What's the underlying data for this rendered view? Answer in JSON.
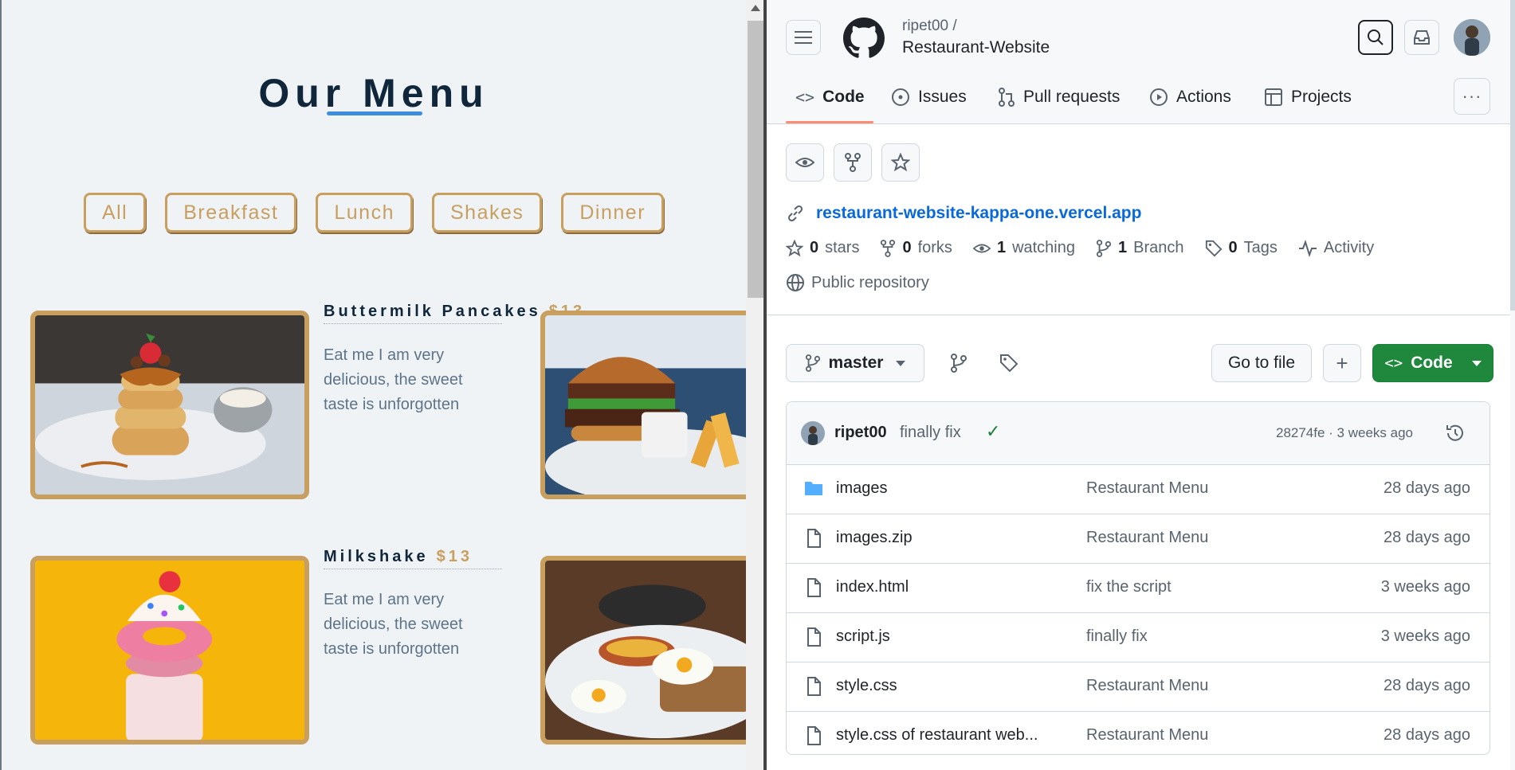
{
  "menu": {
    "title": "Our Menu",
    "filters": [
      "All",
      "Breakfast",
      "Lunch",
      "Shakes",
      "Dinner"
    ],
    "items": [
      {
        "name": "Buttermilk Pancakes",
        "price": "$13",
        "desc": "Eat me I am very delicious, the sweet taste is unforgotten"
      },
      {
        "name": "Milkshake",
        "price": "$13",
        "desc": "Eat me I am very delicious, the sweet taste is unforgotten"
      }
    ]
  },
  "github": {
    "owner": "ripet00 /",
    "repo": "Restaurant-Website",
    "tabs": [
      "Code",
      "Issues",
      "Pull requests",
      "Actions",
      "Projects"
    ],
    "website": "restaurant-website-kappa-one.vercel.app",
    "meta": {
      "stars_count": "0",
      "stars_label": "stars",
      "forks_count": "0",
      "forks_label": "forks",
      "watching_count": "1",
      "watching_label": "watching",
      "branch_count": "1",
      "branch_label": "Branch",
      "tags_count": "0",
      "tags_label": "Tags",
      "activity_label": "Activity",
      "visibility": "Public repository"
    },
    "branch": "master",
    "go_to_file": "Go to file",
    "add_label": "+",
    "code_button": "Code",
    "commit": {
      "author": "ripet00",
      "message": "finally fix",
      "hash_time": "28274fe · 3 weeks ago"
    },
    "files": [
      {
        "name": "images",
        "message": "Restaurant Menu",
        "date": "28 days ago",
        "type": "folder"
      },
      {
        "name": "images.zip",
        "message": "Restaurant Menu",
        "date": "28 days ago",
        "type": "file"
      },
      {
        "name": "index.html",
        "message": "fix the script",
        "date": "3 weeks ago",
        "type": "file"
      },
      {
        "name": "script.js",
        "message": "finally fix",
        "date": "3 weeks ago",
        "type": "file"
      },
      {
        "name": "style.css",
        "message": "Restaurant Menu",
        "date": "28 days ago",
        "type": "file"
      },
      {
        "name": "style.css of restaurant web...",
        "message": "Restaurant Menu",
        "date": "28 days ago",
        "type": "file"
      }
    ],
    "colors": {
      "accent": "#1f883d",
      "link": "#0969da",
      "tab_underline": "#fd8c73",
      "menu_gold": "#c89f5f"
    }
  }
}
